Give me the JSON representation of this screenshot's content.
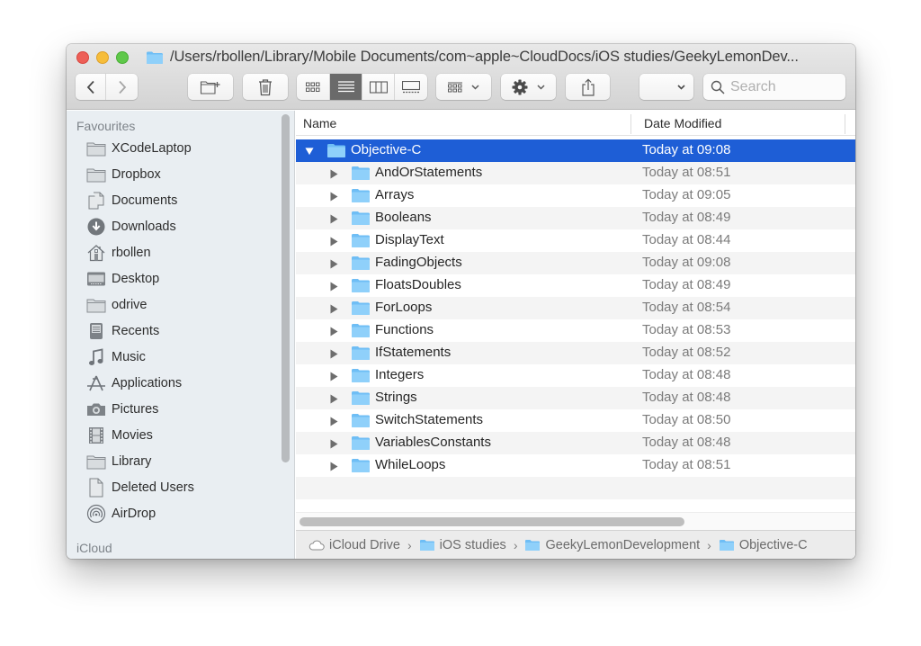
{
  "window": {
    "title": "/Users/rbollen/Library/Mobile Documents/com~apple~CloudDocs/iOS studies/GeekyLemonDev...",
    "accent_color": "#1e5ed6",
    "folder_color": "#6fbef5"
  },
  "toolbar": {
    "back_icon": "chevron-left-icon",
    "forward_icon": "chevron-right-icon",
    "new_folder_icon": "new-folder-icon",
    "trash_icon": "trash-icon",
    "view_modes": [
      {
        "icon": "icon-view-icon",
        "active": false
      },
      {
        "icon": "list-view-icon",
        "active": true
      },
      {
        "icon": "column-view-icon",
        "active": false
      },
      {
        "icon": "gallery-view-icon",
        "active": false
      }
    ],
    "group_icon": "group-by-icon",
    "action_icon": "gear-icon",
    "share_icon": "share-icon",
    "dropdown_value": "",
    "search": {
      "placeholder": "Search"
    }
  },
  "sidebar": {
    "sections": [
      {
        "title": "Favourites",
        "items": [
          {
            "label": "XCodeLaptop",
            "icon": "folder-icon"
          },
          {
            "label": "Dropbox",
            "icon": "folder-icon"
          },
          {
            "label": "Documents",
            "icon": "documents-icon"
          },
          {
            "label": "Downloads",
            "icon": "downloads-icon"
          },
          {
            "label": "rbollen",
            "icon": "home-icon"
          },
          {
            "label": "Desktop",
            "icon": "desktop-icon"
          },
          {
            "label": "odrive",
            "icon": "folder-icon"
          },
          {
            "label": "Recents",
            "icon": "recents-icon"
          },
          {
            "label": "Music",
            "icon": "music-icon"
          },
          {
            "label": "Applications",
            "icon": "applications-icon"
          },
          {
            "label": "Pictures",
            "icon": "camera-icon"
          },
          {
            "label": "Movies",
            "icon": "film-icon"
          },
          {
            "label": "Library",
            "icon": "folder-icon"
          },
          {
            "label": "Deleted Users",
            "icon": "document-icon"
          },
          {
            "label": "AirDrop",
            "icon": "airdrop-icon"
          }
        ]
      },
      {
        "title": "iCloud",
        "items": []
      }
    ]
  },
  "list": {
    "columns": {
      "name": "Name",
      "date": "Date Modified"
    },
    "rows": [
      {
        "name": "Objective-C",
        "date": "Today at 09:08",
        "level": 0,
        "expanded": true,
        "selected": true
      },
      {
        "name": "AndOrStatements",
        "date": "Today at 08:51",
        "level": 1,
        "expanded": false,
        "selected": false
      },
      {
        "name": "Arrays",
        "date": "Today at 09:05",
        "level": 1,
        "expanded": false,
        "selected": false
      },
      {
        "name": "Booleans",
        "date": "Today at 08:49",
        "level": 1,
        "expanded": false,
        "selected": false
      },
      {
        "name": "DisplayText",
        "date": "Today at 08:44",
        "level": 1,
        "expanded": false,
        "selected": false
      },
      {
        "name": "FadingObjects",
        "date": "Today at 09:08",
        "level": 1,
        "expanded": false,
        "selected": false
      },
      {
        "name": "FloatsDoubles",
        "date": "Today at 08:49",
        "level": 1,
        "expanded": false,
        "selected": false
      },
      {
        "name": "ForLoops",
        "date": "Today at 08:54",
        "level": 1,
        "expanded": false,
        "selected": false
      },
      {
        "name": "Functions",
        "date": "Today at 08:53",
        "level": 1,
        "expanded": false,
        "selected": false
      },
      {
        "name": "IfStatements",
        "date": "Today at 08:52",
        "level": 1,
        "expanded": false,
        "selected": false
      },
      {
        "name": "Integers",
        "date": "Today at 08:48",
        "level": 1,
        "expanded": false,
        "selected": false
      },
      {
        "name": "Strings",
        "date": "Today at 08:48",
        "level": 1,
        "expanded": false,
        "selected": false
      },
      {
        "name": "SwitchStatements",
        "date": "Today at 08:50",
        "level": 1,
        "expanded": false,
        "selected": false
      },
      {
        "name": "VariablesConstants",
        "date": "Today at 08:48",
        "level": 1,
        "expanded": false,
        "selected": false
      },
      {
        "name": "WhileLoops",
        "date": "Today at 08:51",
        "level": 1,
        "expanded": false,
        "selected": false
      }
    ]
  },
  "pathbar": {
    "items": [
      {
        "label": "iCloud Drive",
        "icon": "cloud-icon"
      },
      {
        "label": "iOS studies",
        "icon": "folder-icon"
      },
      {
        "label": "GeekyLemonDevelopment",
        "icon": "folder-icon"
      },
      {
        "label": "Objective-C",
        "icon": "folder-icon"
      }
    ],
    "separator": "›"
  }
}
